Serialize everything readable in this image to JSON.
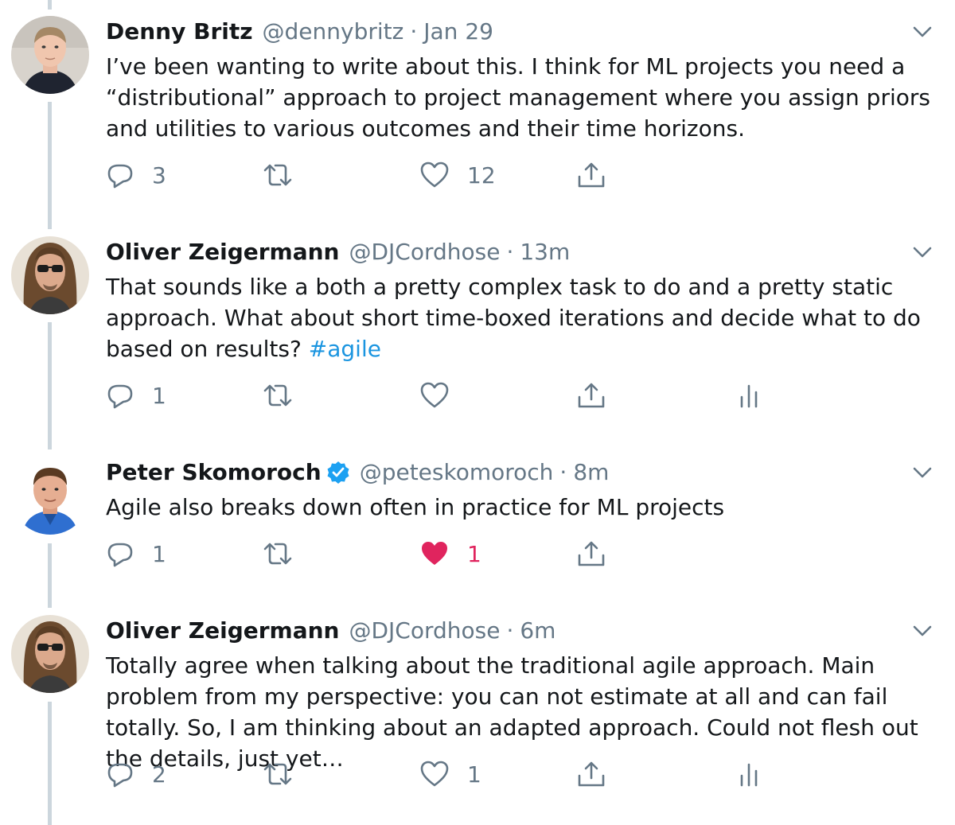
{
  "tweets": [
    {
      "name": "Denny Britz",
      "handle": "@dennybritz",
      "separator": "·",
      "time": "Jan 29",
      "verified": false,
      "body": "I’ve been wanting to write about this. I think for ML projects you need a “distributional” approach to project management where you assign priors and utilities to various outcomes and their time horizons.",
      "hashtag": "",
      "reply_count": "3",
      "retweet_count": "",
      "like_count": "12",
      "liked": false,
      "show_analytics": false
    },
    {
      "name": "Oliver Zeigermann",
      "handle": "@DJCordhose",
      "separator": "·",
      "time": "13m",
      "verified": false,
      "body": "That sounds like a both a pretty complex task to do and a pretty static approach. What about short time-boxed iterations and decide what to do based on results? ",
      "hashtag": "#agile",
      "reply_count": "1",
      "retweet_count": "",
      "like_count": "",
      "liked": false,
      "show_analytics": true
    },
    {
      "name": "Peter Skomoroch",
      "handle": "@peteskomoroch",
      "separator": "·",
      "time": "8m",
      "verified": true,
      "body": "Agile also breaks down often in practice for ML projects",
      "hashtag": "",
      "reply_count": "1",
      "retweet_count": "",
      "like_count": "1",
      "liked": true,
      "show_analytics": false
    },
    {
      "name": "Oliver Zeigermann",
      "handle": "@DJCordhose",
      "separator": "·",
      "time": "6m",
      "verified": false,
      "body": "Totally agree when talking about the traditional agile approach. Main problem from my perspective: you can not estimate at all and can fail totally. So, I am thinking about an adapted approach. Could not flesh out the details, just yet…",
      "hashtag": "",
      "reply_count": "2",
      "retweet_count": "",
      "like_count": "1",
      "liked": false,
      "show_analytics": true
    }
  ],
  "icons": {
    "reply": "reply-icon",
    "retweet": "retweet-icon",
    "like": "heart-icon",
    "share": "share-icon",
    "analytics": "analytics-icon",
    "caret": "chevron-down-icon",
    "verified": "verified-badge-icon"
  },
  "colors": {
    "text": "#14171a",
    "secondary": "#657786",
    "link": "#1b95e0",
    "like_active": "#e0245e",
    "verified": "#1da1f2",
    "thread_line": "#ccd6dd"
  }
}
